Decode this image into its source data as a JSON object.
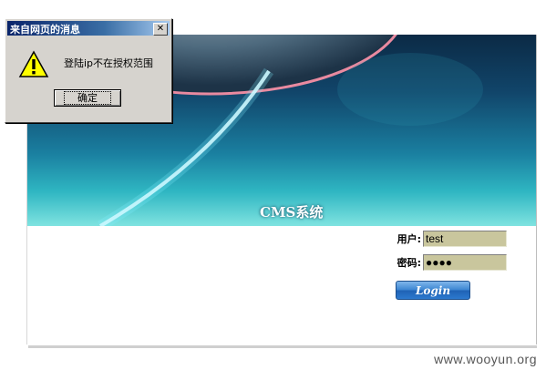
{
  "dialog": {
    "title": "来自网页的消息",
    "close_label": "✕",
    "message": "登陆ip不在授权范围",
    "ok_label": "确定",
    "icon": "warning-icon"
  },
  "banner": {
    "title": "CMS系统"
  },
  "login": {
    "username_label": "用户:",
    "username_value": "test",
    "password_label": "密码:",
    "password_value": "●●●●",
    "button_label": "Login"
  },
  "watermark": "www.wooyun.org",
  "colors": {
    "input_bg": "#c9c69d",
    "button_blue": "#2c79cf",
    "dialog_bg": "#d6d3ce"
  }
}
